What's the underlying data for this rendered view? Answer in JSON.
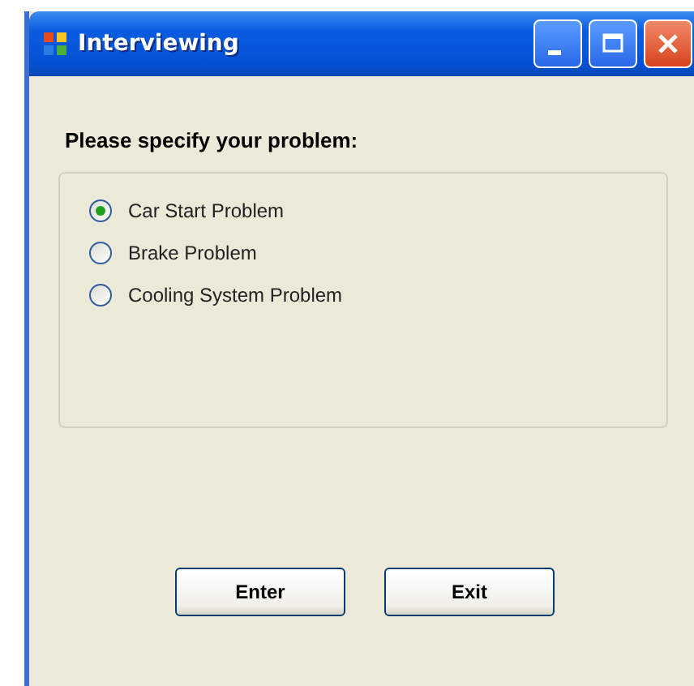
{
  "window": {
    "title": "Interviewing"
  },
  "prompt": "Please specify your problem:",
  "options": [
    {
      "label": "Car Start Problem",
      "selected": true
    },
    {
      "label": "Brake Problem",
      "selected": false
    },
    {
      "label": "Cooling System Problem",
      "selected": false
    }
  ],
  "buttons": [
    "Enter",
    "Exit"
  ]
}
